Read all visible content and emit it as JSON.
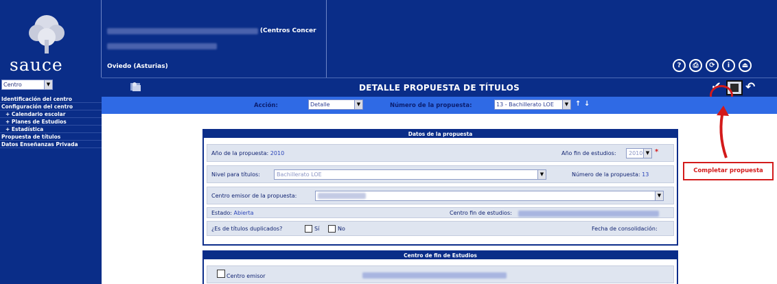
{
  "app": {
    "logo_text": "sauce",
    "center_name_suffix": "(Centros Concer",
    "location": "Oviedo (Asturias)"
  },
  "header_icons": [
    {
      "name": "help-book-icon",
      "glyph": "?"
    },
    {
      "name": "print-icon",
      "glyph": "⎙"
    },
    {
      "name": "refresh-icon",
      "glyph": "⟳"
    },
    {
      "name": "info-icon",
      "glyph": "i"
    },
    {
      "name": "exit-icon",
      "glyph": "⏏"
    }
  ],
  "sidebar": {
    "select_value": "Centro",
    "items": [
      {
        "label": "Identificación del centro",
        "sub": false
      },
      {
        "label": "Configuración del centro",
        "sub": false
      },
      {
        "label": "+ Calendario escolar",
        "sub": true
      },
      {
        "label": "+ Planes de Estudios",
        "sub": true
      },
      {
        "label": "+ Estadística",
        "sub": true
      },
      {
        "label": "Propuesta de títulos",
        "sub": false
      },
      {
        "label": "Datos Enseñanzas Privada",
        "sub": false
      }
    ]
  },
  "title_bar": {
    "title": "DETALLE PROPUESTA DE TÍTULOS"
  },
  "action_bar": {
    "accion_label": "Acción:",
    "accion_value": "Detalle",
    "numero_label": "Número de la propuesta:",
    "numero_value": "13 - Bachillerato LOE"
  },
  "annotation": {
    "label": "Completar propuesta",
    "color": "#d31a1a"
  },
  "panel": {
    "header": "Datos de la propuesta",
    "anio_label": "Año de la propuesta:",
    "anio_value": "2010",
    "anio_fin_label": "Año fin de estudios:",
    "anio_fin_value": "2010",
    "nivel_label": "Nivel para títulos:",
    "nivel_value": "Bachillerato LOE",
    "numero_label": "Número de la propuesta:",
    "numero_value": "13",
    "centro_emisor_label": "Centro emisor de la propuesta:",
    "estado_label": "Estado:",
    "estado_value": "Abierta",
    "centro_fin_label": "Centro fin de estudios:",
    "duplicados_label": "¿Es de títulos duplicados?",
    "si_label": "Sí",
    "no_label": "No",
    "fecha_label": "Fecha de consolidación:"
  },
  "panel2": {
    "header": "Centro de fin de Estudios",
    "centro_emisor_label": "Centro emisor"
  },
  "colors": {
    "primary": "#0a2d88",
    "action_bar": "#2f6ae5",
    "row_bg": "#dfe5f0",
    "required": "#d31a1a"
  }
}
